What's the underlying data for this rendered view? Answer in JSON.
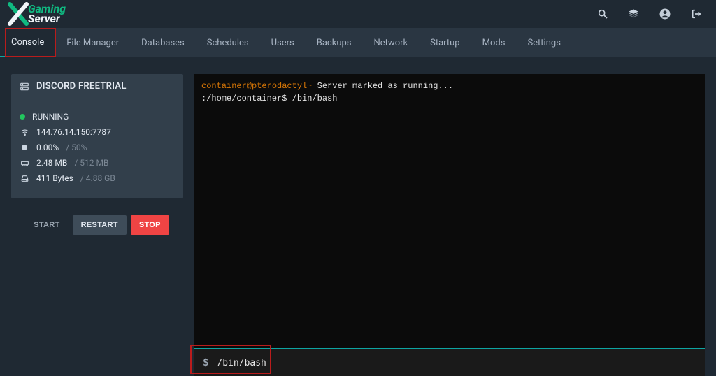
{
  "logo": {
    "line1": "Gaming",
    "line2": "Server"
  },
  "nav": {
    "tabs": [
      {
        "label": "Console",
        "active": true
      },
      {
        "label": "File Manager"
      },
      {
        "label": "Databases"
      },
      {
        "label": "Schedules"
      },
      {
        "label": "Users"
      },
      {
        "label": "Backups"
      },
      {
        "label": "Network"
      },
      {
        "label": "Startup"
      },
      {
        "label": "Mods"
      },
      {
        "label": "Settings"
      }
    ]
  },
  "server": {
    "name": "DISCORD FREETRIAL",
    "status": "RUNNING",
    "address": "144.76.14.150:7787",
    "cpu": {
      "value": "0.00%",
      "max": "/ 50%"
    },
    "mem": {
      "value": "2.48 MB",
      "max": "/ 512 MB"
    },
    "disk": {
      "value": "411 Bytes",
      "max": "/ 4.88 GB"
    }
  },
  "buttons": {
    "start": "START",
    "restart": "RESTART",
    "stop": "STOP"
  },
  "console": {
    "line1_prompt": "container@pterodactyl~ ",
    "line1_text": "Server marked as running...",
    "line2": ":/home/container$ /bin/bash"
  },
  "command": {
    "prompt": "$",
    "value": "/bin/bash"
  }
}
